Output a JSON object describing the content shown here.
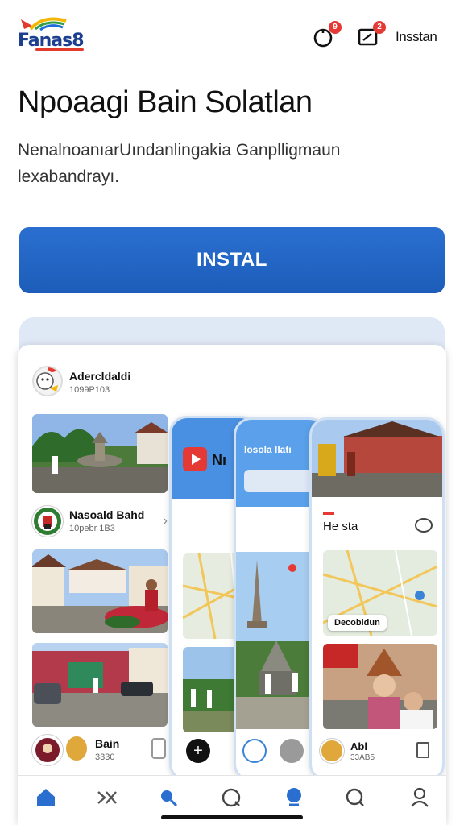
{
  "header": {
    "logo_text": "Fanas8",
    "notif_badge": "9",
    "msg_badge": "2",
    "link_label": "Insstan"
  },
  "hero": {
    "title": "Npoaagi Bain Solatlan",
    "subtitle": "NenalnoanıarUındanlingakia Ganplligmaun lexabandrayı.",
    "install_label": "INSTAL"
  },
  "card": {
    "head_name": "Adercldaldi",
    "head_meta": "1099P103",
    "row1_name": "Nasoald Bahd",
    "row1_meta": "10pebr 1B3",
    "row2_name": "Bain",
    "row2_meta": "3330"
  },
  "phones": {
    "p1_label": "Nı",
    "p2_label": "Iosola Ilatı",
    "p3_title": "He sta",
    "p3_map_label": "Decobidun",
    "p3_row_name": "Abl",
    "p3_row_meta": "33AB5"
  },
  "tabs": [
    "home-icon",
    "shuffle-icon",
    "search-icon",
    "compass-icon",
    "location-icon",
    "search-icon",
    "profile-icon"
  ],
  "colors": {
    "accent": "#1d5db9",
    "badge": "#e53935"
  }
}
